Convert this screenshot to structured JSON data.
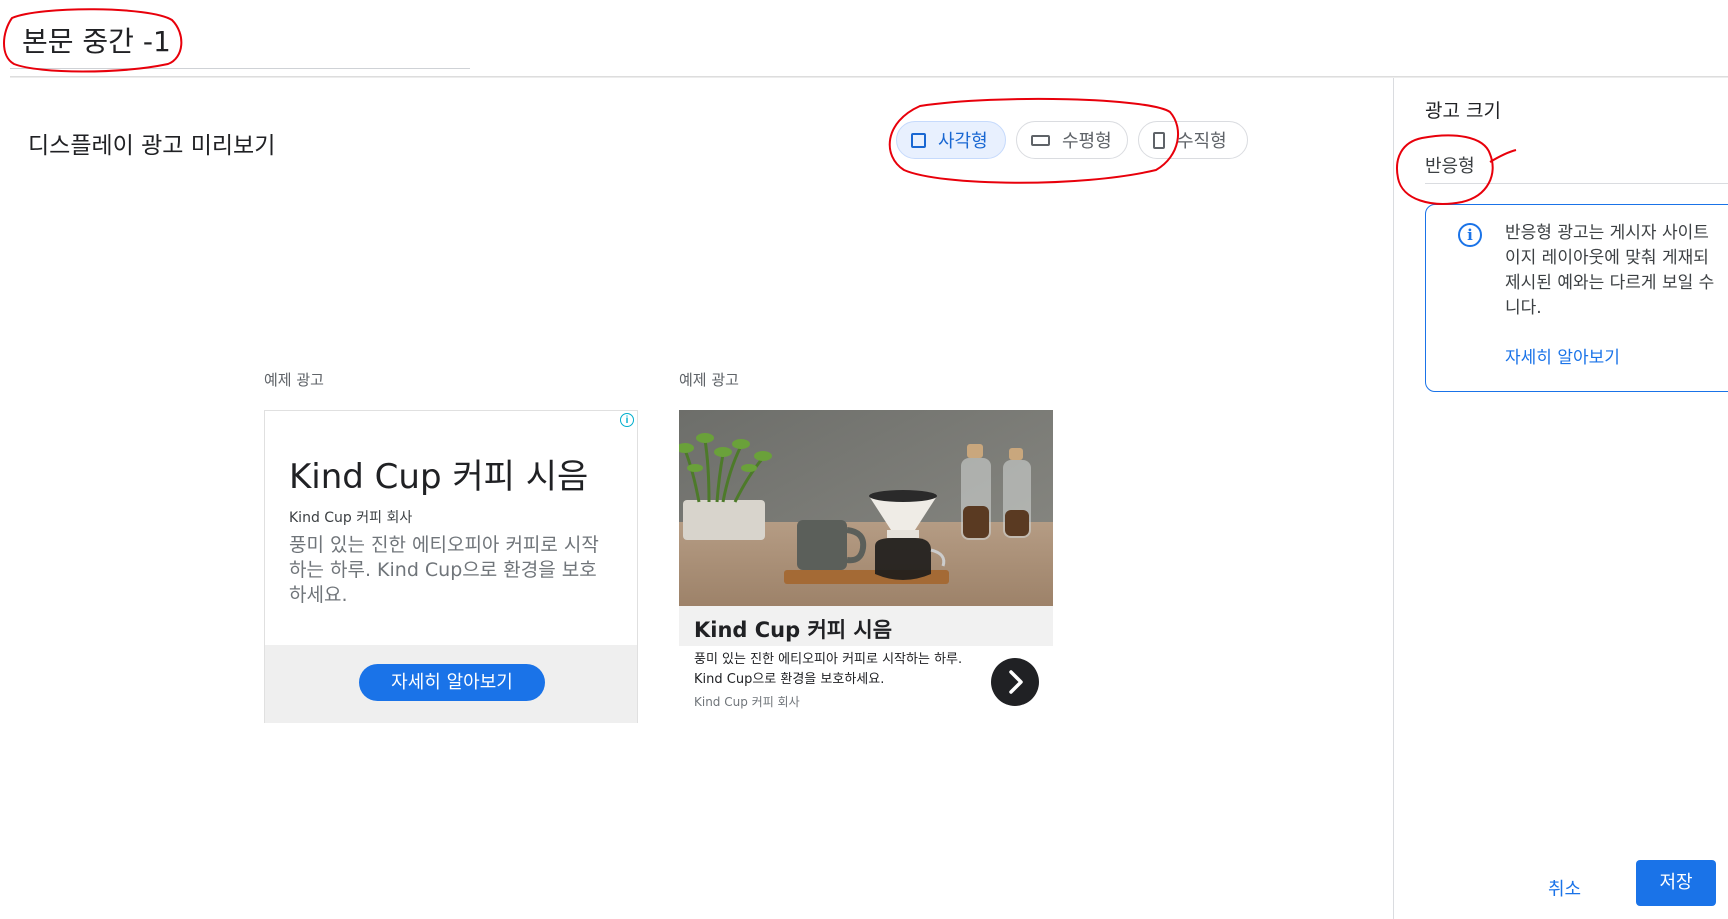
{
  "header": {
    "page_name": "본문 중간 -1"
  },
  "preview": {
    "title": "디스플레이 광고 미리보기",
    "shapes": [
      {
        "label": "사각형",
        "icon": "square-icon",
        "selected": true
      },
      {
        "label": "수평형",
        "icon": "horizontal-rectangle-icon",
        "selected": false
      },
      {
        "label": "수직형",
        "icon": "vertical-rectangle-icon",
        "selected": false
      }
    ]
  },
  "sample_ads": [
    {
      "label": "예제 광고",
      "headline": "Kind Cup 커피 시음",
      "company": "Kind Cup 커피 회사",
      "description": "풍미 있는 진한 에티오피아 커피로 시작하는 하루. Kind Cup으로 환경을 보호하세요.",
      "cta": "자세히 알아보기",
      "adinfo_icon": "i"
    },
    {
      "label": "예제 광고",
      "headline": "Kind Cup 커피 시음",
      "description": "풍미 있는 진한 에티오피아 커피로 시작하는 하루. Kind Cup으로 환경을 보호하세요.",
      "company": "Kind Cup 커피 회사",
      "next_icon": "chevron-right-icon"
    }
  ],
  "side_panel": {
    "title": "광고 크기",
    "size_value": "반응형",
    "info": {
      "icon": "i",
      "text": "반응형 광고는 게시자 사이트\n이지 레이아웃에 맞춰 게재되\n제시된 예와는 다르게 보일 수\n니다.",
      "link": "자세히 알아보기"
    }
  },
  "footer": {
    "cancel": "취소",
    "save": "저장"
  },
  "colors": {
    "accent": "#1a73e8",
    "annotation": "#e8000b",
    "selected_bg": "#e8f0fe"
  }
}
